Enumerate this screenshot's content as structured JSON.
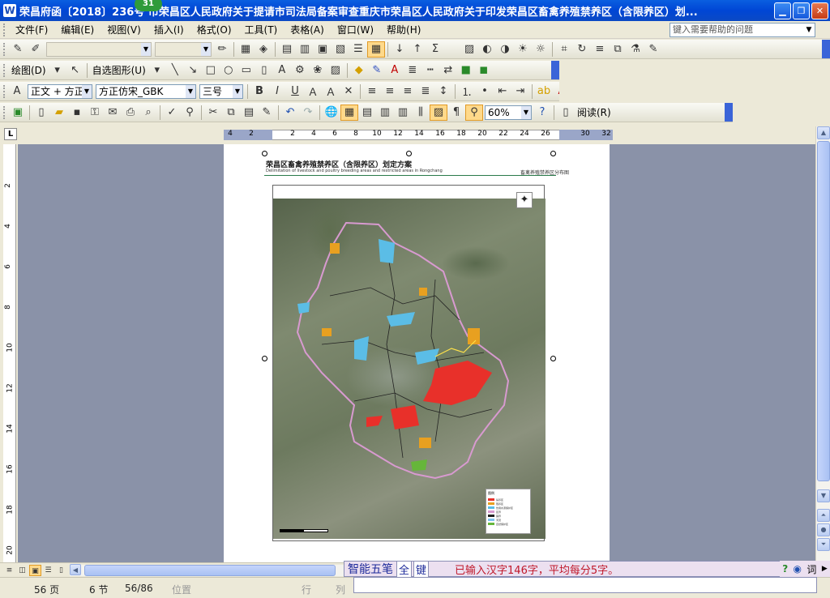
{
  "window": {
    "badge": "31",
    "title": "荣昌府函〔2018〕236号 市荣昌区人民政府关于提请市司法局备案审查重庆市荣昌区人民政府关于印发荣昌区畜禽养殖禁养区（含限养区）划...",
    "minimize": "▁",
    "restore": "❐",
    "close": "✕"
  },
  "menu": {
    "items": [
      "文件(F)",
      "编辑(E)",
      "视图(V)",
      "插入(I)",
      "格式(O)",
      "工具(T)",
      "表格(A)",
      "窗口(W)",
      "帮助(H)"
    ],
    "help_placeholder": "键入需要帮助的问题"
  },
  "toolbar_drawing": {
    "draw_label": "绘图(D)",
    "autoshape_label": "自选图形(U)"
  },
  "toolbar_format": {
    "style": "正文 + 方正",
    "font": "方正仿宋_GBK",
    "size": "三号"
  },
  "toolbar_standard": {
    "zoom": "60%",
    "read_label": "阅读(R)"
  },
  "ruler": {
    "numbers": [
      "4",
      "2",
      "2",
      "4",
      "6",
      "8",
      "10",
      "12",
      "14",
      "16",
      "18",
      "20",
      "22",
      "24",
      "26",
      "30",
      "32"
    ],
    "vertical_numbers": [
      "2",
      "4",
      "6",
      "8",
      "10",
      "12",
      "14",
      "16",
      "18",
      "20"
    ]
  },
  "document": {
    "map_title": "荣昌区畜禽养殖禁养区（含限养区）划定方案",
    "map_subtitle": "Delimitation of livestock and poultry breeding areas and restricted areas in Rongchang",
    "map_tag": "畜禽养殖禁养区分布图",
    "compass": "✦",
    "legend_title": "图例",
    "legend": [
      {
        "label": "禁养区",
        "color": "#e8302a"
      },
      {
        "label": "限养区",
        "color": "#e8a020"
      },
      {
        "label": "饮用水源保护区",
        "color": "#5bbde6"
      },
      {
        "label": "区界",
        "color": "#d89ad0"
      },
      {
        "label": "镇界",
        "color": "#222222"
      },
      {
        "label": "河流",
        "color": "#7fc4f0"
      },
      {
        "label": "自然保护区",
        "color": "#66b63a"
      }
    ]
  },
  "statusbar": {
    "page": "56 页",
    "section": "6 节",
    "page_of": "56/86",
    "position": "位置",
    "line": "行",
    "col": "列"
  },
  "ime": {
    "name": "智能五笔",
    "mode1": "全",
    "mode2": "键",
    "info": "已输入汉字146字，平均每分5字。"
  }
}
